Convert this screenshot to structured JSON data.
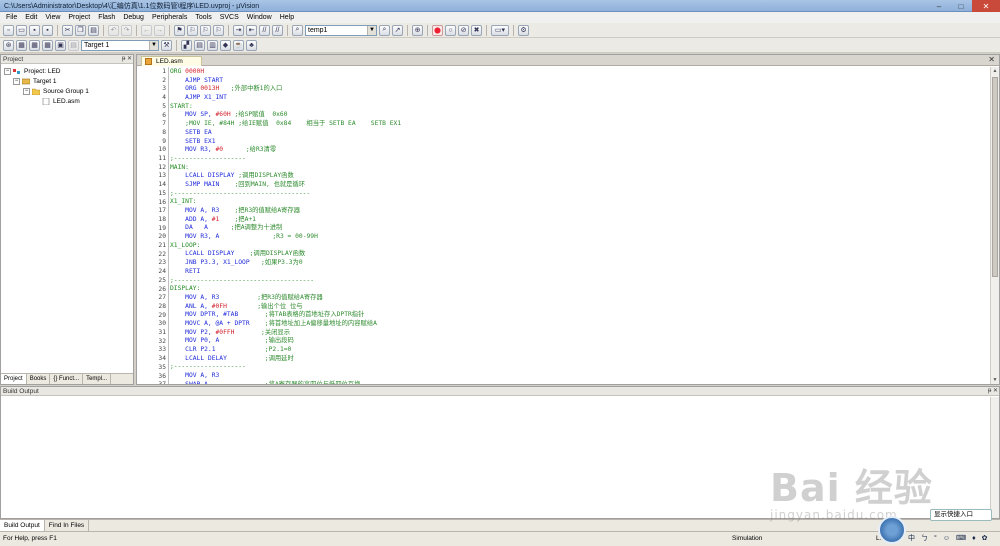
{
  "window": {
    "title": "C:\\Users\\Administrator\\Desktop\\4\\汇编仿真\\1.1位数码管\\程序\\LED.uvproj - µVision",
    "controls": [
      "–",
      "□",
      "✕"
    ]
  },
  "menu": [
    "File",
    "Edit",
    "View",
    "Project",
    "Flash",
    "Debug",
    "Peripherals",
    "Tools",
    "SVCS",
    "Window",
    "Help"
  ],
  "toolbar": {
    "search_combo_value": "temp1",
    "target_combo_value": "Target 1"
  },
  "project_panel": {
    "header": "Project",
    "pin": "ᵽ",
    "close": "✕",
    "tree": [
      {
        "toggle": "−",
        "label": "Project: LED",
        "level": 0,
        "icon": "project-icon"
      },
      {
        "toggle": "−",
        "label": "Target 1",
        "level": 1,
        "icon": "target-icon"
      },
      {
        "toggle": "−",
        "label": "Source Group 1",
        "level": 2,
        "icon": "folder-icon"
      },
      {
        "toggle": "",
        "label": "LED.asm",
        "level": 3,
        "icon": "file-icon"
      }
    ],
    "tabs": [
      "Project",
      "Books",
      "{} Funct...",
      "Templ..."
    ]
  },
  "editor": {
    "tab_label": "LED.asm",
    "close": "✕",
    "lines": [
      [
        [
          "lbl",
          "ORG "
        ],
        [
          "num",
          "0000H"
        ]
      ],
      [
        [
          "",
          "    "
        ],
        [
          "kw",
          "AJMP START"
        ]
      ],
      [
        [
          "",
          "    "
        ],
        [
          "kw",
          "ORG "
        ],
        [
          "num",
          "0013H"
        ],
        [
          "cm",
          "   ;外部中断1的入口"
        ]
      ],
      [
        [
          "",
          "    "
        ],
        [
          "kw",
          "AJMP X1_INT"
        ]
      ],
      [
        [
          "lbl",
          "START:"
        ]
      ],
      [
        [
          "",
          "    "
        ],
        [
          "kw",
          "MOV SP, "
        ],
        [
          "num",
          "#60H"
        ],
        [
          "cm",
          " ;给SP赋值  0x60"
        ]
      ],
      [
        [
          "",
          "    "
        ],
        [
          "cm",
          ";MOV IE, #84H ;给IE赋值  0x84    相当于 SETB EA    SETB EX1"
        ]
      ],
      [
        [
          "",
          "    "
        ],
        [
          "kw",
          "SETB EA"
        ]
      ],
      [
        [
          "",
          "    "
        ],
        [
          "kw",
          "SETB EX1"
        ]
      ],
      [
        [
          "",
          "    "
        ],
        [
          "kw",
          "MOV R3, "
        ],
        [
          "num",
          "#0"
        ],
        [
          "cm",
          "      ;给R3清零"
        ]
      ],
      [
        [
          "cm",
          ";-------------------"
        ]
      ],
      [
        [
          "lbl",
          "MAIN:"
        ]
      ],
      [
        [
          "",
          "    "
        ],
        [
          "kw",
          "LCALL DISPLAY"
        ],
        [
          "cm",
          " ;调用DISPLAY函数"
        ]
      ],
      [
        [
          "",
          "    "
        ],
        [
          "kw",
          "SJMP MAIN"
        ],
        [
          "cm",
          "    ;回到MAIN, 也就是循环"
        ]
      ],
      [
        [
          "cm",
          ";------------------------------------"
        ]
      ],
      [
        [
          "lbl",
          "X1_INT:"
        ]
      ],
      [
        [
          "",
          "    "
        ],
        [
          "kw",
          "MOV A, R3"
        ],
        [
          "cm",
          "    ;把R3的值赋给A寄存器"
        ]
      ],
      [
        [
          "",
          "    "
        ],
        [
          "kw",
          "ADD A, "
        ],
        [
          "num",
          "#1"
        ],
        [
          "cm",
          "    ;把A+1"
        ]
      ],
      [
        [
          "",
          "    "
        ],
        [
          "kw",
          "DA   A"
        ],
        [
          "cm",
          "      ;把A调整为十进制"
        ]
      ],
      [
        [
          "",
          "    "
        ],
        [
          "kw",
          "MOV R3, A"
        ],
        [
          "cm",
          "              ;R3 = 00-99H"
        ]
      ],
      [
        [
          "lbl",
          "X1_LOOP:"
        ]
      ],
      [
        [
          "",
          "    "
        ],
        [
          "kw",
          "LCALL DISPLAY"
        ],
        [
          "cm",
          "    ;调用DISPLAY函数"
        ]
      ],
      [
        [
          "",
          "    "
        ],
        [
          "kw",
          "JNB P3.3, X1_LOOP"
        ],
        [
          "cm",
          "   ;如果P3.3为0"
        ]
      ],
      [
        [
          "",
          "    "
        ],
        [
          "kw",
          "RETI"
        ]
      ],
      [
        [
          "cm",
          ";-------------------------------------"
        ]
      ],
      [
        [
          "lbl",
          "DISPLAY:"
        ]
      ],
      [
        [
          "",
          "    "
        ],
        [
          "kw",
          "MOV A, R3"
        ],
        [
          "cm",
          "          ;把R3的值赋给A寄存器"
        ]
      ],
      [
        [
          "",
          "    "
        ],
        [
          "kw",
          "ANL A, "
        ],
        [
          "num",
          "#0FH"
        ],
        [
          "cm",
          "        ;输出个位 位与"
        ]
      ],
      [
        [
          "",
          "    "
        ],
        [
          "kw",
          "MOV DPTR, #TAB"
        ],
        [
          "cm",
          "       ;将TAB表格的首地址存入DPTR指针"
        ]
      ],
      [
        [
          "",
          "    "
        ],
        [
          "kw",
          "MOVC A, @A + DPTR"
        ],
        [
          "cm",
          "    ;将首地址加上A偏移量地址的内容赋给A"
        ]
      ],
      [
        [
          "",
          "    "
        ],
        [
          "kw",
          "MOV P2, "
        ],
        [
          "num",
          "#0FFH"
        ],
        [
          "cm",
          "       ;关闭显示"
        ]
      ],
      [
        [
          "",
          "    "
        ],
        [
          "kw",
          "MOV P0, A"
        ],
        [
          "cm",
          "            ;输出段码"
        ]
      ],
      [
        [
          "",
          "    "
        ],
        [
          "kw",
          "CLR P2.1"
        ],
        [
          "cm",
          "             ;P2.1=0"
        ]
      ],
      [
        [
          "",
          "    "
        ],
        [
          "kw",
          "LCALL DELAY"
        ],
        [
          "cm",
          "          ;调用延时"
        ]
      ],
      [
        [
          "cm",
          ";-------------------"
        ]
      ],
      [
        [
          "",
          "    "
        ],
        [
          "kw",
          "MOV A, R3"
        ]
      ],
      [
        [
          "",
          "    "
        ],
        [
          "kw",
          "SWAP A"
        ],
        [
          "cm",
          "               ;将A寄存器的高四位与低四位互换"
        ]
      ]
    ]
  },
  "build_output": {
    "header": "Build Output",
    "pin": "ᵽ",
    "close": "✕",
    "tabs": [
      "Build Output",
      "Find In Files"
    ]
  },
  "status": {
    "help": "For Help, press F1",
    "mode": "Simulation",
    "position": "L:53"
  },
  "overlay": {
    "watermark_big": "Bai 经验",
    "watermark_small": "jingyan.baidu.com",
    "shortcut_label": "显示快捷入口",
    "ime": [
      "中",
      "ㄅ",
      "°",
      "☺",
      "⌨",
      "♦",
      "✿"
    ]
  }
}
